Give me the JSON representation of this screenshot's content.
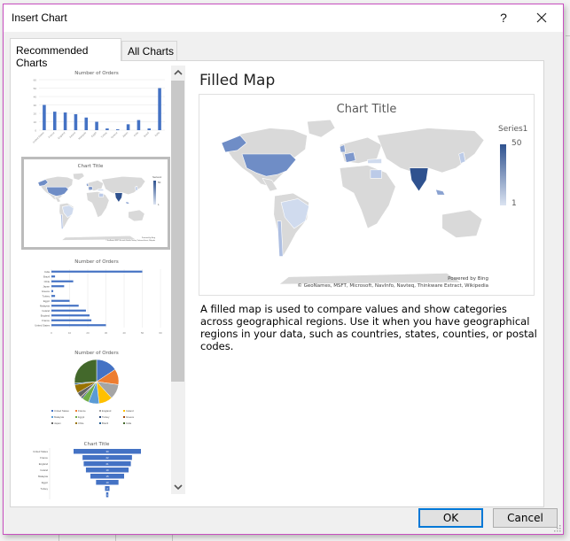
{
  "window": {
    "title": "Insert Chart",
    "help_label": "?",
    "close_icon": "close-icon"
  },
  "tabs": [
    {
      "label": "Recommended Charts",
      "active": true
    },
    {
      "label": "All Charts",
      "active": false
    }
  ],
  "thumbnails": [
    {
      "type": "column",
      "title": "Number of Orders",
      "selected": false
    },
    {
      "type": "filled-map",
      "title": "Chart Title",
      "selected": true
    },
    {
      "type": "bar",
      "title": "Number of Orders",
      "selected": false
    },
    {
      "type": "pie",
      "title": "Number of Orders",
      "selected": false
    },
    {
      "type": "funnel",
      "title": "Chart Title",
      "selected": false
    }
  ],
  "detail": {
    "chart_type_name": "Filled Map",
    "preview": {
      "title": "Chart Title",
      "legend_title": "Series1",
      "legend_max": "50",
      "legend_min": "1",
      "powered_by": "Powered by Bing",
      "attribution": "© GeoNames, MSFT, Microsoft, NavInfo, Navteq, Thinkware Extract, Wikipedia",
      "color_low": "#dbe3f1",
      "color_high": "#2f528f",
      "land_color": "#d9d9d9"
    },
    "description": "A filled map is used to compare values and show categories across geographical regions. Use it when you have geographical regions in your data, such as countries, states, counties, or postal codes."
  },
  "buttons": {
    "ok": "OK",
    "cancel": "Cancel"
  },
  "chart_data": {
    "type": "bar",
    "title": "Number of Orders",
    "categories": [
      "United States",
      "France",
      "England",
      "Ireland",
      "Malaysia",
      "Egypt",
      "Turkey",
      "Greece",
      "Japan",
      "Chile",
      "Brazil",
      "India"
    ],
    "values": [
      30,
      22,
      21,
      19,
      15,
      10,
      2,
      1,
      7,
      12,
      2,
      50
    ],
    "ylim": [
      0,
      60
    ],
    "yticks": [
      "0",
      "10",
      "20",
      "30",
      "40",
      "50",
      "60"
    ],
    "pie_colors": [
      "#4472c4",
      "#ed7d31",
      "#a5a5a5",
      "#ffc000",
      "#5b9bd5",
      "#70ad47",
      "#264478",
      "#9e480e",
      "#636363",
      "#997300",
      "#255e91",
      "#43682b"
    ],
    "funnel_labels": [
      "30",
      "22",
      "21",
      "19",
      "15",
      "10",
      "2",
      "1"
    ]
  }
}
